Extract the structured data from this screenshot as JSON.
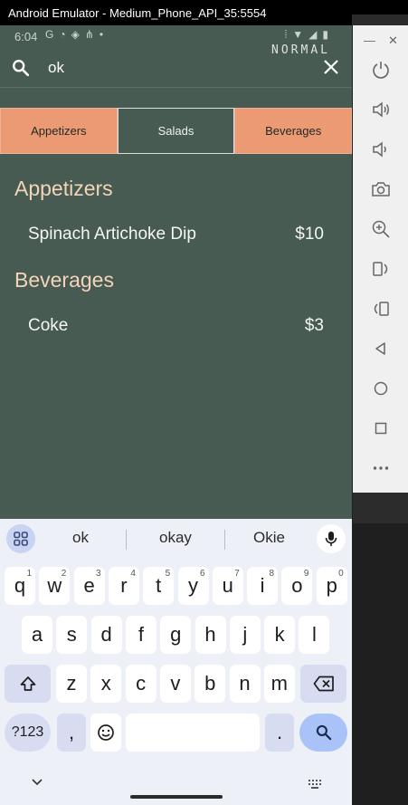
{
  "window": {
    "title": "Android Emulator - Medium_Phone_API_35:5554"
  },
  "status_bar": {
    "time": "6:04",
    "mode_tag": "NORMAL"
  },
  "search": {
    "query": "ok"
  },
  "tabs": [
    {
      "label": "Appetizers",
      "active": false
    },
    {
      "label": "Salads",
      "active": true
    },
    {
      "label": "Beverages",
      "active": false
    }
  ],
  "sections": [
    {
      "title": "Appetizers",
      "items": [
        {
          "name": "Spinach Artichoke Dip",
          "price": "$10"
        }
      ]
    },
    {
      "title": "Beverages",
      "items": [
        {
          "name": "Coke",
          "price": "$3"
        }
      ]
    }
  ],
  "keyboard": {
    "suggestions": [
      "ok",
      "okay",
      "Okie"
    ],
    "row1": [
      {
        "k": "q",
        "h": "1"
      },
      {
        "k": "w",
        "h": "2"
      },
      {
        "k": "e",
        "h": "3"
      },
      {
        "k": "r",
        "h": "4"
      },
      {
        "k": "t",
        "h": "5"
      },
      {
        "k": "y",
        "h": "6"
      },
      {
        "k": "u",
        "h": "7"
      },
      {
        "k": "i",
        "h": "8"
      },
      {
        "k": "o",
        "h": "9"
      },
      {
        "k": "p",
        "h": "0"
      }
    ],
    "row2": [
      "a",
      "s",
      "d",
      "f",
      "g",
      "h",
      "j",
      "k",
      "l"
    ],
    "row3": [
      "z",
      "x",
      "c",
      "v",
      "b",
      "n",
      "m"
    ],
    "symbols_label": "?123",
    "comma": ",",
    "period": "."
  },
  "colors": {
    "background": "#475b53",
    "tab_inactive": "#ec9a73",
    "section_title": "#f3d4b8"
  },
  "icons": {
    "sidebar": [
      "power-icon",
      "volume-up-icon",
      "volume-down-icon",
      "camera-icon",
      "zoom-icon",
      "rotate-left-icon",
      "rotate-right-icon",
      "back-icon",
      "home-icon",
      "overview-icon",
      "more-icon"
    ]
  }
}
